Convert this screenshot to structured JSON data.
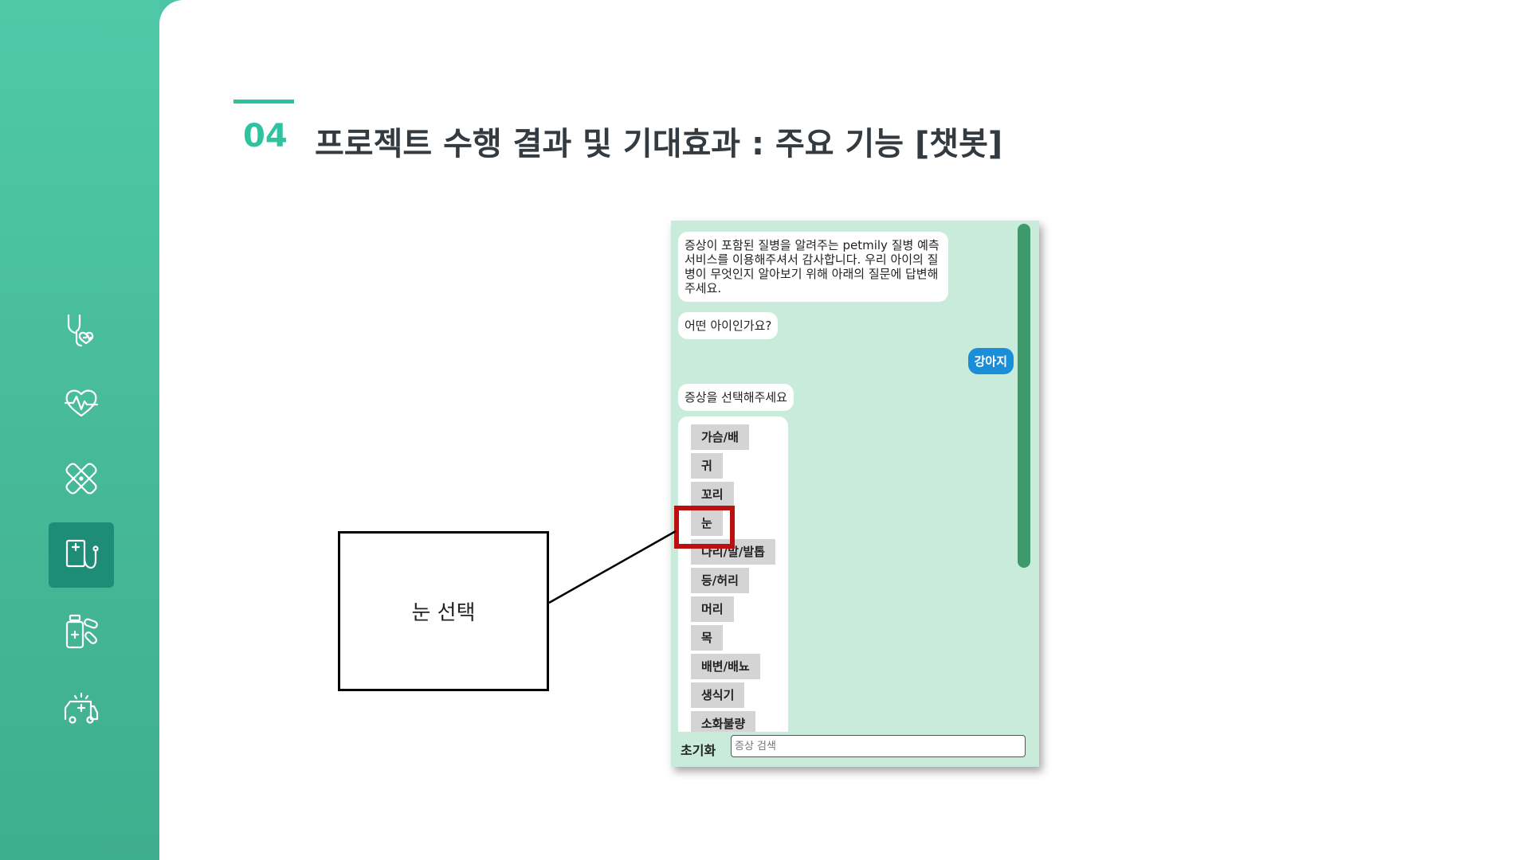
{
  "sidebar": {
    "icons": [
      "stethoscope-heart-icon",
      "heartbeat-icon",
      "bandage-icon",
      "clipboard-stethoscope-icon",
      "medicine-pills-icon",
      "ambulance-icon"
    ],
    "active_index": 3
  },
  "header": {
    "section_number": "04",
    "title": "프로젝트 수행 결과 및 기대효과 : 주요 기능 [챗봇]"
  },
  "chat": {
    "welcome_message": "증상이 포함된 질병을 알려주는 petmily 질병 예측 서비스를 이용해주셔서 감사합니다. 우리 아이의 질병이 무엇인지 알아보기 위해 아래의 질문에 답변해주세요.",
    "question_pet": "어떤 아이인가요?",
    "user_answer": "강아지",
    "question_symptom": "증상을 선택해주세요",
    "symptom_options": [
      "가슴/배",
      "귀",
      "꼬리",
      "눈",
      "다리/발/발톱",
      "등/허리",
      "머리",
      "목",
      "배변/배뇨",
      "생식기",
      "소화불량"
    ],
    "selected_option": "눈",
    "reset_label": "초기화",
    "search_placeholder": "증상 검색"
  },
  "callout": {
    "text": "눈 선택"
  },
  "colors": {
    "accent": "#2ec39f",
    "sidebar": "#46b998",
    "chat_bg": "#c9ebdb",
    "user_bubble": "#1b8ed9",
    "highlight": "#bb1010"
  }
}
